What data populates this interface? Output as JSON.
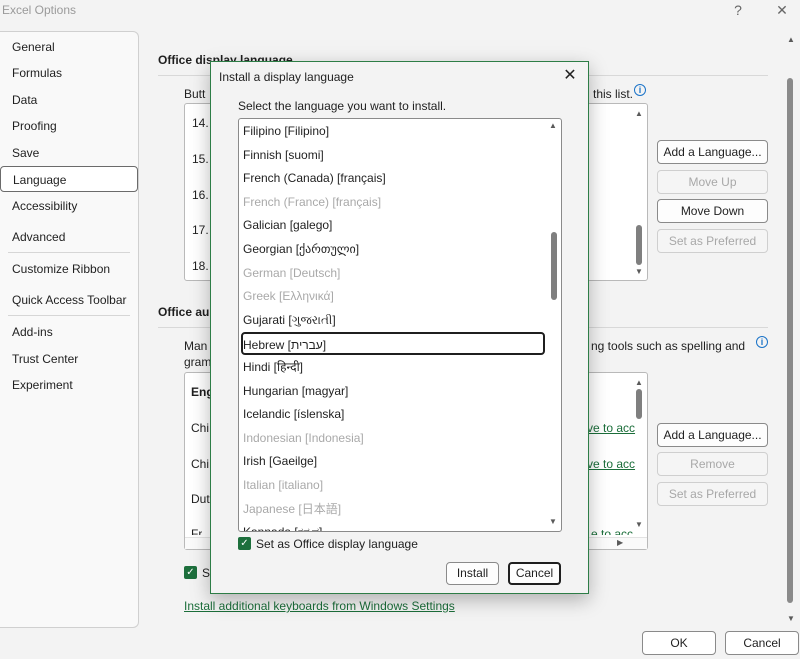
{
  "window": {
    "title": "Excel Options",
    "help_label": "?",
    "close_label": "✕"
  },
  "nav": {
    "items": [
      {
        "label": "General"
      },
      {
        "label": "Formulas"
      },
      {
        "label": "Data"
      },
      {
        "label": "Proofing"
      },
      {
        "label": "Save"
      },
      {
        "label": "Language",
        "selected": true
      },
      {
        "label": "Accessibility"
      },
      {
        "label": "Advanced"
      },
      {
        "label": "Customize Ribbon"
      },
      {
        "label": "Quick Access Toolbar"
      },
      {
        "label": "Add-ins"
      },
      {
        "label": "Trust Center"
      },
      {
        "label": "Experiment"
      }
    ]
  },
  "display_section": {
    "heading": "Office display language",
    "desc_left": "Butt",
    "desc_right": "this list.",
    "list_numbers": [
      "14.",
      "15.",
      "16.",
      "17.",
      "18."
    ],
    "buttons": {
      "add": "Add a Language...",
      "move_up": "Move Up",
      "move_down": "Move Down",
      "set_preferred": "Set as Preferred"
    }
  },
  "authoring_section": {
    "heading": "Office au",
    "desc_left_1": "Man",
    "desc_left_2": "gram",
    "desc_right": "ng tools such as spelling and",
    "rows": [
      {
        "left": "Eng",
        "right": ""
      },
      {
        "left": "Chi",
        "right": "ve to acc"
      },
      {
        "left": "Chi",
        "right": "ve to acc"
      },
      {
        "left": "Dut",
        "right": ""
      },
      {
        "left": "Fr",
        "right": "e to acc"
      }
    ],
    "buttons": {
      "add": "Add a Language...",
      "remove": "Remove",
      "set_preferred": "Set as Preferred"
    },
    "checkbox_label_partial": "S",
    "keyboards_link": "Install additional keyboards from Windows Settings"
  },
  "footer": {
    "ok": "OK",
    "cancel": "Cancel"
  },
  "dialog": {
    "title": "Install a display language",
    "close_label": "✕",
    "prompt": "Select the language you want to install.",
    "languages": [
      {
        "label": "Filipino [Filipino]",
        "disabled": false
      },
      {
        "label": "Finnish [suomi]",
        "disabled": false
      },
      {
        "label": "French (Canada) [français]",
        "disabled": false
      },
      {
        "label": "French (France) [français]",
        "disabled": true
      },
      {
        "label": "Galician [galego]",
        "disabled": false
      },
      {
        "label": "Georgian [ქართული]",
        "disabled": false
      },
      {
        "label": "German [Deutsch]",
        "disabled": true
      },
      {
        "label": "Greek [Ελληνικά]",
        "disabled": true
      },
      {
        "label": "Gujarati [ગુજરાતી]",
        "disabled": false
      },
      {
        "label": "Hebrew [עברית]",
        "disabled": false,
        "focused": true
      },
      {
        "label": "Hindi [हिन्दी]",
        "disabled": false
      },
      {
        "label": "Hungarian [magyar]",
        "disabled": false
      },
      {
        "label": "Icelandic [íslenska]",
        "disabled": false
      },
      {
        "label": "Indonesian [Indonesia]",
        "disabled": true
      },
      {
        "label": "Irish [Gaeilge]",
        "disabled": false
      },
      {
        "label": "Italian [italiano]",
        "disabled": true
      },
      {
        "label": "Japanese [日本語]",
        "disabled": true
      },
      {
        "label": "Kannada [ಕನ್ನಡ]",
        "disabled": false
      }
    ],
    "checkbox_label": "Set as Office display language",
    "checkbox_checked": true,
    "install": "Install",
    "cancel": "Cancel"
  },
  "colors": {
    "accent_green": "#1d6f3c",
    "link_green": "#1b6e3a",
    "info_blue": "#1a73c8"
  }
}
